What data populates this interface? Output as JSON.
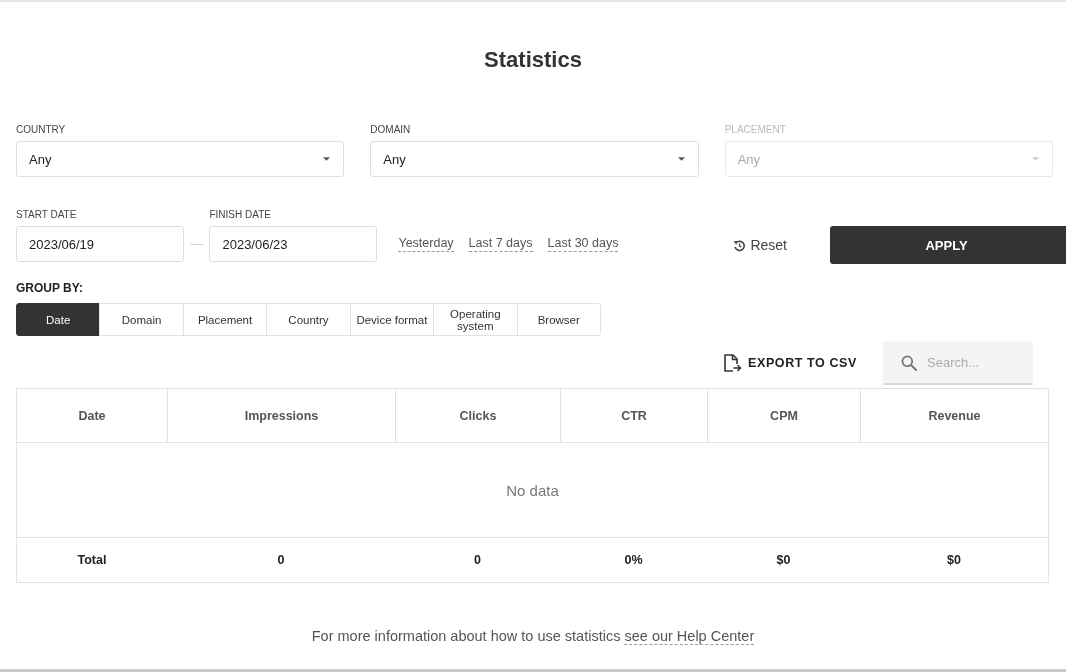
{
  "title": "Statistics",
  "filters": [
    {
      "label": "COUNTRY",
      "value": "Any",
      "disabled": false
    },
    {
      "label": "DOMAIN",
      "value": "Any",
      "disabled": false
    },
    {
      "label": "PLACEMENT",
      "value": "Any",
      "disabled": true
    }
  ],
  "dates": [
    {
      "label": "START DATE",
      "value": "2023/06/19"
    },
    {
      "label": "FINISH DATE",
      "value": "2023/06/23"
    }
  ],
  "date_separator": "—",
  "presets": [
    "Yesterday",
    "Last 7 days",
    "Last 30 days"
  ],
  "reset_button": "Reset",
  "apply_button": "APPLY",
  "group_by": {
    "label": "GROUP BY:",
    "options": [
      {
        "label": "Date",
        "selected": true
      },
      {
        "label": "Domain",
        "selected": false
      },
      {
        "label": "Placement",
        "selected": false
      },
      {
        "label": "Country",
        "selected": false
      },
      {
        "label": "Device format",
        "selected": false
      },
      {
        "label": "Operating system",
        "selected": false
      },
      {
        "label": "Browser",
        "selected": false
      }
    ]
  },
  "export_button": "EXPORT TO CSV",
  "search": {
    "placeholder": "Search..."
  },
  "table": {
    "columns": [
      "Date",
      "Impressions",
      "Clicks",
      "CTR",
      "CPM",
      "Revenue"
    ],
    "empty_text": "No data",
    "total_row": [
      "Total",
      "0",
      "0",
      "0%",
      "$0",
      "$0"
    ]
  },
  "footer": {
    "text": "For more information about how to use statistics",
    "link": "see our Help Center"
  }
}
